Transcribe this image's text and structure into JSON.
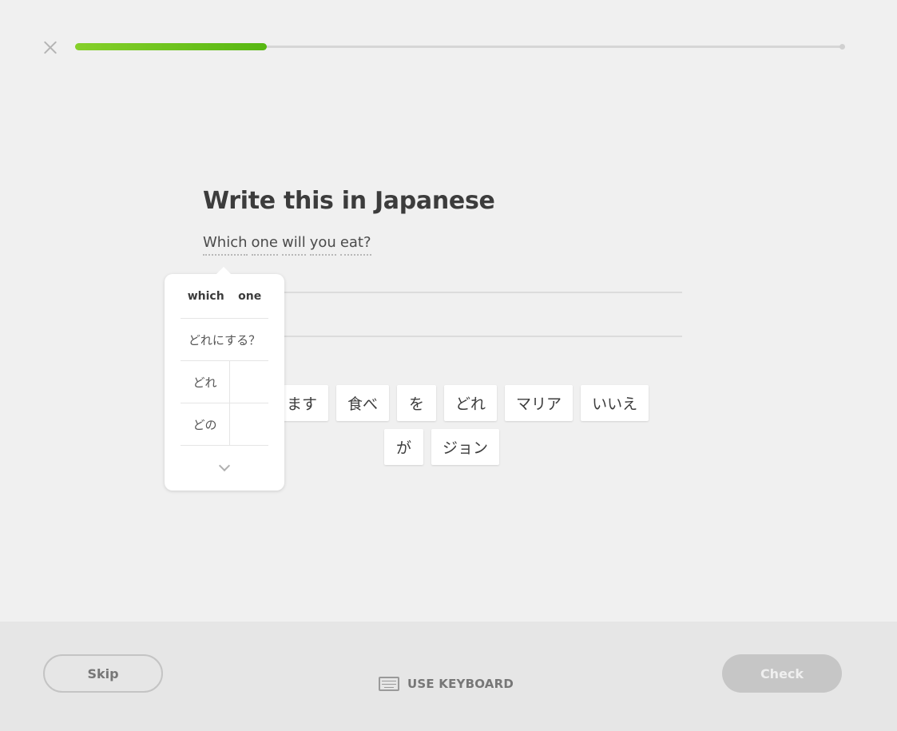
{
  "header": {
    "close_icon": "close-icon",
    "progress_fraction": 0.25
  },
  "prompt": {
    "title": "Write this in Japanese",
    "words": [
      "Which",
      "one",
      "will",
      "you",
      "eat?"
    ]
  },
  "hint": {
    "head": [
      "which",
      "one"
    ],
    "phrase": "どれにする？",
    "rows": [
      "どれ",
      "どの"
    ],
    "more_icon": "chevron-down-icon"
  },
  "word_bank": {
    "row1": [
      "ます",
      "食べ",
      "を",
      "どれ",
      "マリア",
      "いいえ"
    ],
    "row2": [
      "が",
      "ジョン"
    ]
  },
  "footer": {
    "skip_label": "Skip",
    "keyboard_label": "USE KEYBOARD",
    "keyboard_icon": "keyboard-icon",
    "check_label": "Check"
  },
  "colors": {
    "progress": "#58b712",
    "background": "#f0f0f0",
    "footer": "#e6e6e6",
    "check_disabled": "#c6c6c6"
  }
}
